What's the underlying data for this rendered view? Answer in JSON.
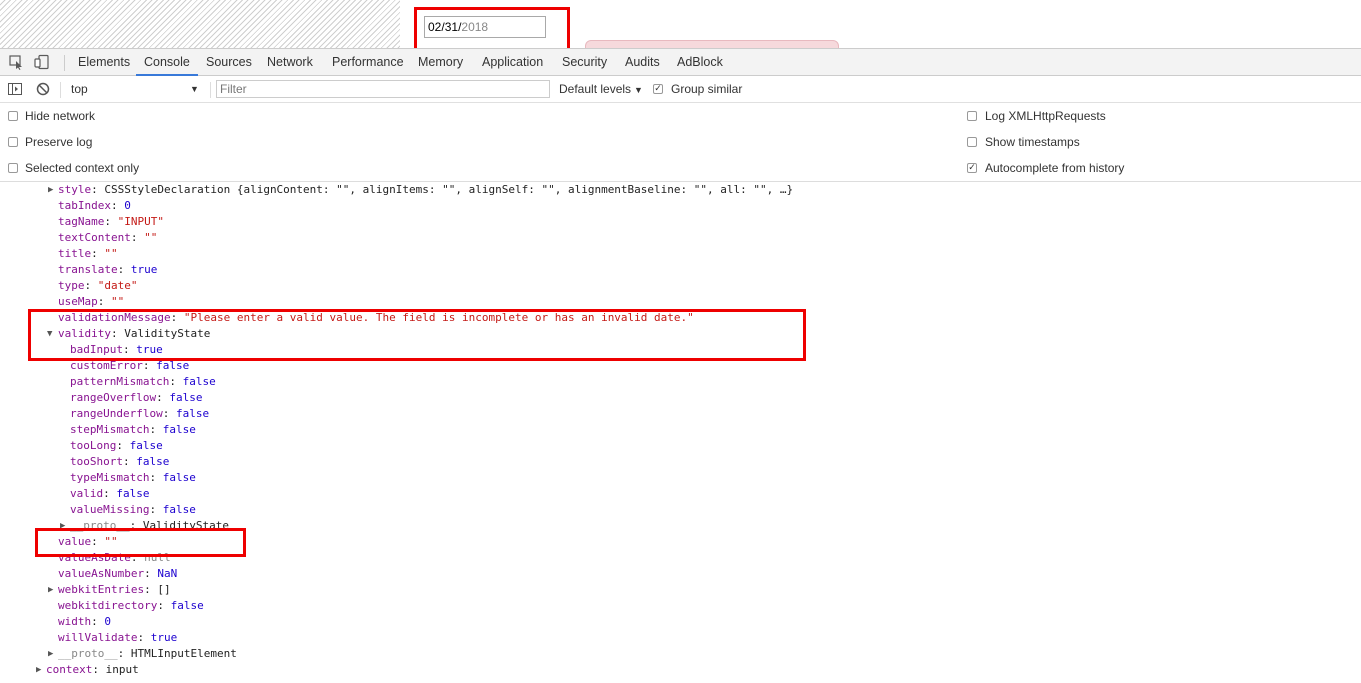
{
  "page": {
    "date_input": {
      "month": "02",
      "day": "31",
      "year": "2018",
      "sep": "/"
    }
  },
  "devtools": {
    "tabs": [
      "Elements",
      "Console",
      "Sources",
      "Network",
      "Performance",
      "Memory",
      "Application",
      "Security",
      "Audits",
      "AdBlock"
    ],
    "active_tab": "Console",
    "toolbar": {
      "context": "top",
      "filter_placeholder": "Filter",
      "levels": "Default levels",
      "group_similar": "Group similar"
    },
    "settings": {
      "left": [
        "Hide network",
        "Preserve log",
        "Selected context only"
      ],
      "right": [
        "Log XMLHttpRequests",
        "Show timestamps",
        "Autocomplete from history"
      ],
      "right_checked": [
        false,
        false,
        true
      ]
    }
  },
  "console": {
    "lines": [
      {
        "key": "style",
        "sep": ": ",
        "val": "CSSStyleDeclaration {alignContent: \"\", alignItems: \"\", alignSelf: \"\", alignmentBaseline: \"\", all: \"\", …}"
      },
      {
        "key": "tabIndex",
        "sep": ": ",
        "val": "0"
      },
      {
        "key": "tagName",
        "sep": ": ",
        "val": "\"INPUT\""
      },
      {
        "key": "textContent",
        "sep": ": ",
        "val": "\"\""
      },
      {
        "key": "title",
        "sep": ": ",
        "val": "\"\""
      },
      {
        "key": "translate",
        "sep": ": ",
        "val": "true"
      },
      {
        "key": "type",
        "sep": ": ",
        "val": "\"date\""
      },
      {
        "key": "useMap",
        "sep": ": ",
        "val": "\"\""
      },
      {
        "key": "validationMessage",
        "sep": ": ",
        "val": "\"Please enter a valid value. The field is incomplete or has an invalid date.\""
      },
      {
        "key": "validity",
        "sep": ": ",
        "val": "ValidityState"
      },
      {
        "key": "badInput",
        "sep": ": ",
        "val": "true"
      },
      {
        "key": "customError",
        "sep": ": ",
        "val": "false"
      },
      {
        "key": "patternMismatch",
        "sep": ": ",
        "val": "false"
      },
      {
        "key": "rangeOverflow",
        "sep": ": ",
        "val": "false"
      },
      {
        "key": "rangeUnderflow",
        "sep": ": ",
        "val": "false"
      },
      {
        "key": "stepMismatch",
        "sep": ": ",
        "val": "false"
      },
      {
        "key": "tooLong",
        "sep": ": ",
        "val": "false"
      },
      {
        "key": "tooShort",
        "sep": ": ",
        "val": "false"
      },
      {
        "key": "typeMismatch",
        "sep": ": ",
        "val": "false"
      },
      {
        "key": "valid",
        "sep": ": ",
        "val": "false"
      },
      {
        "key": "valueMissing",
        "sep": ": ",
        "val": "false"
      },
      {
        "key": "__proto__",
        "sep": ": ",
        "val": "ValidityState"
      },
      {
        "key": "value",
        "sep": ": ",
        "val": "\"\""
      },
      {
        "key": "valueAsDate",
        "sep": ": ",
        "val": "null"
      },
      {
        "key": "valueAsNumber",
        "sep": ": ",
        "val": "NaN"
      },
      {
        "key": "webkitEntries",
        "sep": ": ",
        "val": "[]"
      },
      {
        "key": "webkitdirectory",
        "sep": ": ",
        "val": "false"
      },
      {
        "key": "width",
        "sep": ": ",
        "val": "0"
      },
      {
        "key": "willValidate",
        "sep": ": ",
        "val": "true"
      },
      {
        "key": "__proto__",
        "sep": ": ",
        "val": "HTMLInputElement"
      },
      {
        "key": "context",
        "sep": ": ",
        "val": "input"
      }
    ]
  },
  "colors": {
    "accent": "#3879d9",
    "highlight": "#ee0000",
    "key": "#881391",
    "string": "#c41a16",
    "number": "#1c00cf"
  }
}
